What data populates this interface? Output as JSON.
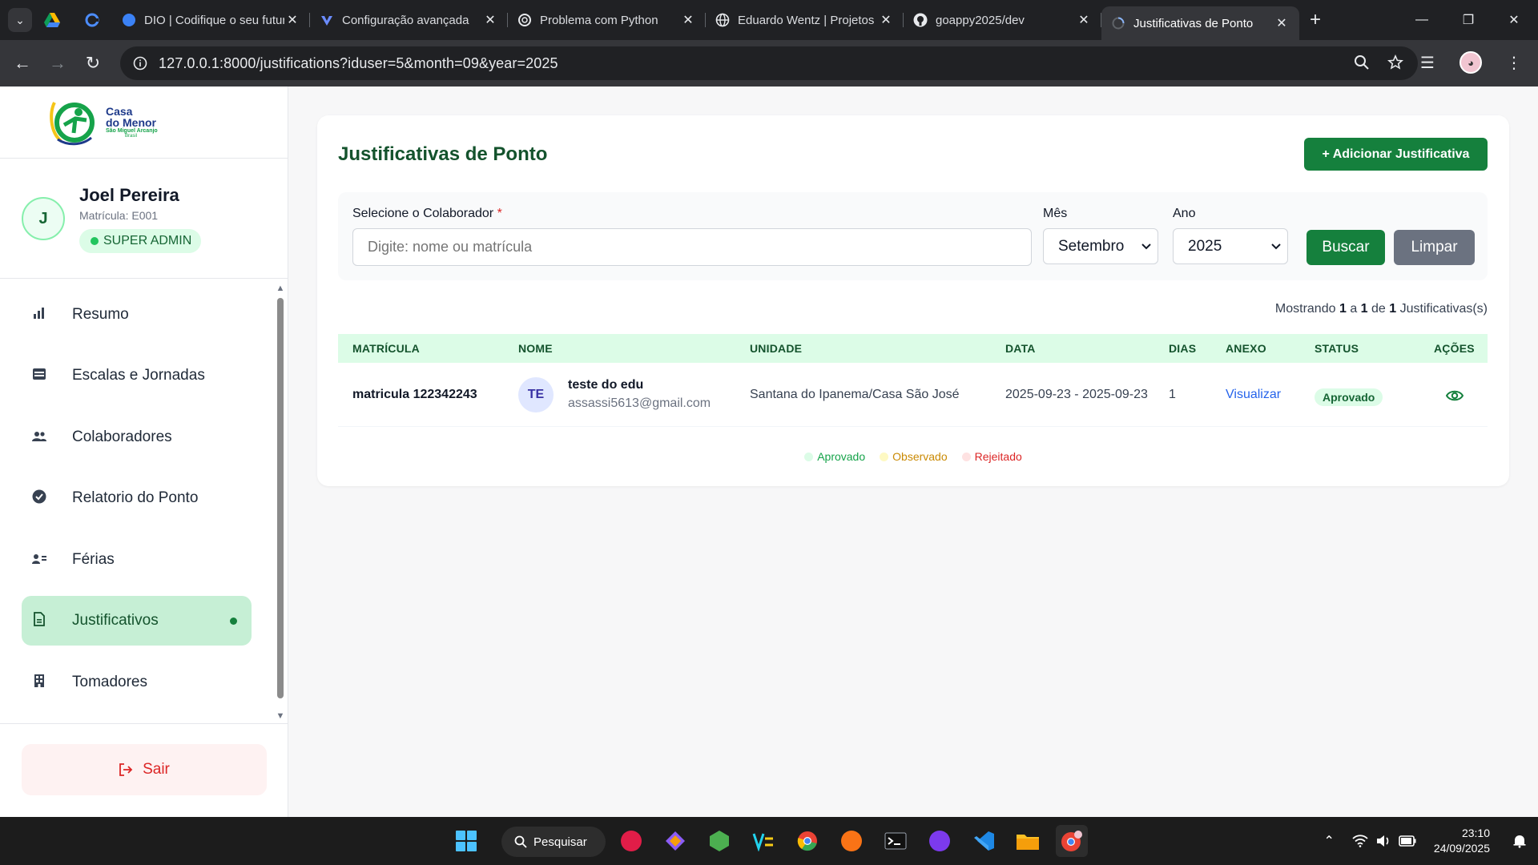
{
  "browser": {
    "tabs": [
      {
        "title": "DIO | Codifique o seu futuro",
        "icon": "dio-icon"
      },
      {
        "title": "Configuração avançada",
        "icon": "sparkle-icon"
      },
      {
        "title": "Problema com Python",
        "icon": "openai-icon"
      },
      {
        "title": "Eduardo Wentz | Projetos",
        "icon": "globe-icon"
      },
      {
        "title": "goappy2025/dev",
        "icon": "github-icon"
      },
      {
        "title": "Justificativas de Ponto",
        "icon": "loading-icon",
        "active": true
      }
    ],
    "url": "127.0.0.1:8000/justifications?iduser=5&month=09&year=2025"
  },
  "sidebar": {
    "logo": {
      "line1": "Casa",
      "line2": "do Menor",
      "line3": "São Miguel Arcanjo",
      "line4": "Brasil"
    },
    "user": {
      "initial": "J",
      "name": "Joel Pereira",
      "matricula": "Matrícula: E001",
      "role": "SUPER ADMIN"
    },
    "menu": [
      {
        "label": "Resumo",
        "icon": "bar-chart-icon"
      },
      {
        "label": "Escalas e Jornadas",
        "icon": "calendar-icon"
      },
      {
        "label": "Colaboradores",
        "icon": "users-icon"
      },
      {
        "label": "Relatorio do Ponto",
        "icon": "check-circle-icon"
      },
      {
        "label": "Férias",
        "icon": "user-list-icon"
      },
      {
        "label": "Justificativos",
        "icon": "document-icon",
        "active": true
      },
      {
        "label": "Tomadores",
        "icon": "building-icon"
      }
    ],
    "logout_label": "Sair"
  },
  "main": {
    "title": "Justificativas de Ponto",
    "add_button": "+ Adicionar Justificativa",
    "filters": {
      "collaborator_label": "Selecione o Colaborador",
      "required_mark": "*",
      "collaborator_placeholder": "Digite: nome ou matrícula",
      "month_label": "Mês",
      "month_value": "Setembro",
      "year_label": "Ano",
      "year_value": "2025",
      "search_button": "Buscar",
      "clear_button": "Limpar"
    },
    "showing": {
      "prefix": "Mostrando",
      "from": "1",
      "mid": "a",
      "to": "1",
      "of": "de",
      "total": "1",
      "suffix": "Justificativas(s)"
    },
    "table": {
      "headers": [
        "MATRÍCULA",
        "NOME",
        "UNIDADE",
        "DATA",
        "DIAS",
        "ANEXO",
        "STATUS",
        "AÇÕES"
      ],
      "rows": [
        {
          "matricula": "matricula 122342243",
          "initials": "TE",
          "name": "teste do edu",
          "email": "assassi5613@gmail.com",
          "unidade": "Santana do Ipanema/Casa São José",
          "data": "2025-09-23 - 2025-09-23",
          "dias": "1",
          "anexo": "Visualizar",
          "status": "Aprovado"
        }
      ]
    },
    "legend": [
      {
        "label": "Aprovado",
        "color": "#16a34a",
        "dot": "#dcfce7"
      },
      {
        "label": "Observado",
        "color": "#ca8a04",
        "dot": "#fef9c3"
      },
      {
        "label": "Rejeitado",
        "color": "#dc2626",
        "dot": "#fee2e2"
      }
    ]
  },
  "taskbar": {
    "search_label": "Pesquisar",
    "time": "23:10",
    "date": "24/09/2025"
  },
  "colors": {
    "brand_green": "#15803d",
    "brand_dark": "#14532d",
    "accent_light": "#dcfce7"
  }
}
